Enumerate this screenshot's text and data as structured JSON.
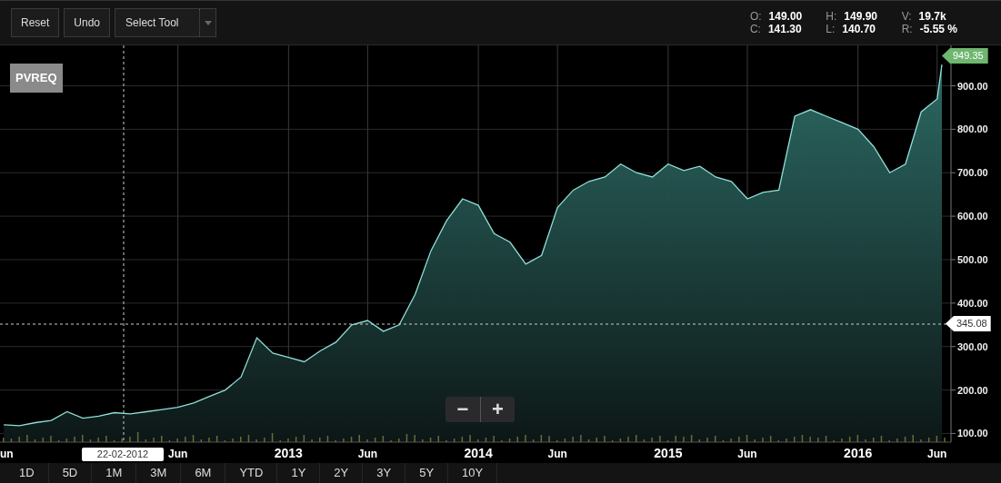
{
  "toolbar": {
    "buttons": [
      "Reset",
      "Undo"
    ],
    "tool_select": {
      "value": "Select Tool"
    }
  },
  "ohlc": [
    {
      "label": "O:",
      "value": "149.00"
    },
    {
      "label": "H:",
      "value": "149.90"
    },
    {
      "label": "V:",
      "value": "19.7k"
    },
    {
      "label": "C:",
      "value": "141.30"
    },
    {
      "label": "L:",
      "value": "140.70"
    },
    {
      "label": "R:",
      "value": "-5.55 %"
    }
  ],
  "x_axis_cut_label": "un",
  "last_price": "949.35",
  "crosshair": {
    "price_label": "345.08",
    "date_label": "22-02-2012"
  },
  "chart_data": {
    "type": "area",
    "x": [
      2011.5,
      2011.583,
      2011.667,
      2011.75,
      2011.833,
      2011.917,
      2012,
      2012.083,
      2012.167,
      2012.25,
      2012.333,
      2012.417,
      2012.5,
      2012.583,
      2012.667,
      2012.75,
      2012.833,
      2012.917,
      2013,
      2013.083,
      2013.167,
      2013.25,
      2013.333,
      2013.417,
      2013.5,
      2013.583,
      2013.667,
      2013.75,
      2013.833,
      2013.917,
      2014,
      2014.083,
      2014.167,
      2014.25,
      2014.333,
      2014.417,
      2014.5,
      2014.583,
      2014.667,
      2014.75,
      2014.833,
      2014.917,
      2015,
      2015.083,
      2015.167,
      2015.25,
      2015.333,
      2015.417,
      2015.5,
      2015.583,
      2015.667,
      2015.75,
      2015.833,
      2015.917,
      2016,
      2016.083,
      2016.167,
      2016.25,
      2016.333,
      2016.417,
      2016.442
    ],
    "series": [
      {
        "name": "PVREQ",
        "color": "#8fe0d8",
        "values": [
          120,
          118,
          125,
          130,
          150,
          135,
          140,
          148,
          145,
          150,
          155,
          160,
          170,
          185,
          200,
          230,
          320,
          285,
          275,
          265,
          290,
          310,
          350,
          360,
          335,
          350,
          420,
          520,
          590,
          640,
          625,
          560,
          540,
          490,
          510,
          620,
          660,
          680,
          690,
          720,
          700,
          690,
          720,
          705,
          715,
          690,
          680,
          640,
          655,
          660,
          830,
          845,
          830,
          815,
          800,
          760,
          700,
          720,
          840,
          870,
          949
        ]
      }
    ],
    "xlim": [
      2011.48,
      2016.49
    ],
    "ylim": [
      80,
      993
    ],
    "grid": true,
    "xticks": [
      {
        "value": 2012.417,
        "label": "Jun"
      },
      {
        "value": 2013,
        "label": "2013"
      },
      {
        "value": 2013.417,
        "label": "Jun"
      },
      {
        "value": 2014,
        "label": "2014"
      },
      {
        "value": 2014.417,
        "label": "Jun"
      },
      {
        "value": 2015,
        "label": "2015"
      },
      {
        "value": 2015.417,
        "label": "Jun"
      },
      {
        "value": 2016,
        "label": "2016"
      },
      {
        "value": 2016.417,
        "label": "Jun"
      }
    ],
    "yticks": [
      {
        "value": 100,
        "label": "100.00"
      },
      {
        "value": 200,
        "label": "200.00"
      },
      {
        "value": 300,
        "label": "300.00"
      },
      {
        "value": 400,
        "label": "400.00"
      },
      {
        "value": 500,
        "label": "500.00"
      },
      {
        "value": 600,
        "label": "600.00"
      },
      {
        "value": 700,
        "label": "700.00"
      },
      {
        "value": 800,
        "label": "800.00"
      },
      {
        "value": 900,
        "label": "900.00"
      }
    ]
  },
  "zoom_controls": [
    "−",
    "+"
  ],
  "ranges": [
    {
      "label": "1D",
      "selected": false
    },
    {
      "label": "5D",
      "selected": false
    },
    {
      "label": "1M",
      "selected": false
    },
    {
      "label": "3M",
      "selected": false
    },
    {
      "label": "6M",
      "selected": false
    },
    {
      "label": "YTD",
      "selected": false
    },
    {
      "label": "1Y",
      "selected": false
    },
    {
      "label": "2Y",
      "selected": false
    },
    {
      "label": "3Y",
      "selected": false
    },
    {
      "label": "5Y",
      "selected": false
    },
    {
      "label": "10Y",
      "selected": false
    }
  ]
}
